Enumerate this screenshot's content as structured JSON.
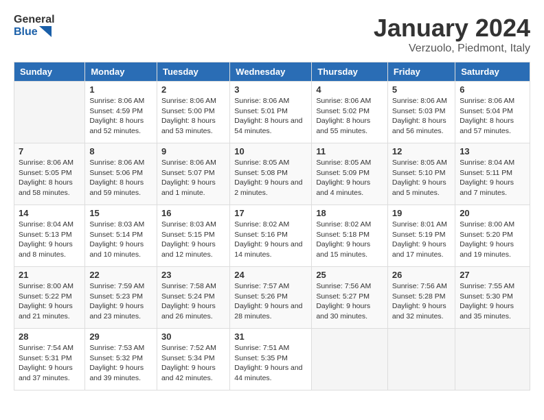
{
  "logo": {
    "text_general": "General",
    "text_blue": "Blue"
  },
  "header": {
    "month": "January 2024",
    "location": "Verzuolo, Piedmont, Italy"
  },
  "weekdays": [
    "Sunday",
    "Monday",
    "Tuesday",
    "Wednesday",
    "Thursday",
    "Friday",
    "Saturday"
  ],
  "weeks": [
    [
      {
        "day": "",
        "sunrise": "",
        "sunset": "",
        "daylight": ""
      },
      {
        "day": "1",
        "sunrise": "Sunrise: 8:06 AM",
        "sunset": "Sunset: 4:59 PM",
        "daylight": "Daylight: 8 hours and 52 minutes."
      },
      {
        "day": "2",
        "sunrise": "Sunrise: 8:06 AM",
        "sunset": "Sunset: 5:00 PM",
        "daylight": "Daylight: 8 hours and 53 minutes."
      },
      {
        "day": "3",
        "sunrise": "Sunrise: 8:06 AM",
        "sunset": "Sunset: 5:01 PM",
        "daylight": "Daylight: 8 hours and 54 minutes."
      },
      {
        "day": "4",
        "sunrise": "Sunrise: 8:06 AM",
        "sunset": "Sunset: 5:02 PM",
        "daylight": "Daylight: 8 hours and 55 minutes."
      },
      {
        "day": "5",
        "sunrise": "Sunrise: 8:06 AM",
        "sunset": "Sunset: 5:03 PM",
        "daylight": "Daylight: 8 hours and 56 minutes."
      },
      {
        "day": "6",
        "sunrise": "Sunrise: 8:06 AM",
        "sunset": "Sunset: 5:04 PM",
        "daylight": "Daylight: 8 hours and 57 minutes."
      }
    ],
    [
      {
        "day": "7",
        "sunrise": "Sunrise: 8:06 AM",
        "sunset": "Sunset: 5:05 PM",
        "daylight": "Daylight: 8 hours and 58 minutes."
      },
      {
        "day": "8",
        "sunrise": "Sunrise: 8:06 AM",
        "sunset": "Sunset: 5:06 PM",
        "daylight": "Daylight: 8 hours and 59 minutes."
      },
      {
        "day": "9",
        "sunrise": "Sunrise: 8:06 AM",
        "sunset": "Sunset: 5:07 PM",
        "daylight": "Daylight: 9 hours and 1 minute."
      },
      {
        "day": "10",
        "sunrise": "Sunrise: 8:05 AM",
        "sunset": "Sunset: 5:08 PM",
        "daylight": "Daylight: 9 hours and 2 minutes."
      },
      {
        "day": "11",
        "sunrise": "Sunrise: 8:05 AM",
        "sunset": "Sunset: 5:09 PM",
        "daylight": "Daylight: 9 hours and 4 minutes."
      },
      {
        "day": "12",
        "sunrise": "Sunrise: 8:05 AM",
        "sunset": "Sunset: 5:10 PM",
        "daylight": "Daylight: 9 hours and 5 minutes."
      },
      {
        "day": "13",
        "sunrise": "Sunrise: 8:04 AM",
        "sunset": "Sunset: 5:11 PM",
        "daylight": "Daylight: 9 hours and 7 minutes."
      }
    ],
    [
      {
        "day": "14",
        "sunrise": "Sunrise: 8:04 AM",
        "sunset": "Sunset: 5:13 PM",
        "daylight": "Daylight: 9 hours and 8 minutes."
      },
      {
        "day": "15",
        "sunrise": "Sunrise: 8:03 AM",
        "sunset": "Sunset: 5:14 PM",
        "daylight": "Daylight: 9 hours and 10 minutes."
      },
      {
        "day": "16",
        "sunrise": "Sunrise: 8:03 AM",
        "sunset": "Sunset: 5:15 PM",
        "daylight": "Daylight: 9 hours and 12 minutes."
      },
      {
        "day": "17",
        "sunrise": "Sunrise: 8:02 AM",
        "sunset": "Sunset: 5:16 PM",
        "daylight": "Daylight: 9 hours and 14 minutes."
      },
      {
        "day": "18",
        "sunrise": "Sunrise: 8:02 AM",
        "sunset": "Sunset: 5:18 PM",
        "daylight": "Daylight: 9 hours and 15 minutes."
      },
      {
        "day": "19",
        "sunrise": "Sunrise: 8:01 AM",
        "sunset": "Sunset: 5:19 PM",
        "daylight": "Daylight: 9 hours and 17 minutes."
      },
      {
        "day": "20",
        "sunrise": "Sunrise: 8:00 AM",
        "sunset": "Sunset: 5:20 PM",
        "daylight": "Daylight: 9 hours and 19 minutes."
      }
    ],
    [
      {
        "day": "21",
        "sunrise": "Sunrise: 8:00 AM",
        "sunset": "Sunset: 5:22 PM",
        "daylight": "Daylight: 9 hours and 21 minutes."
      },
      {
        "day": "22",
        "sunrise": "Sunrise: 7:59 AM",
        "sunset": "Sunset: 5:23 PM",
        "daylight": "Daylight: 9 hours and 23 minutes."
      },
      {
        "day": "23",
        "sunrise": "Sunrise: 7:58 AM",
        "sunset": "Sunset: 5:24 PM",
        "daylight": "Daylight: 9 hours and 26 minutes."
      },
      {
        "day": "24",
        "sunrise": "Sunrise: 7:57 AM",
        "sunset": "Sunset: 5:26 PM",
        "daylight": "Daylight: 9 hours and 28 minutes."
      },
      {
        "day": "25",
        "sunrise": "Sunrise: 7:56 AM",
        "sunset": "Sunset: 5:27 PM",
        "daylight": "Daylight: 9 hours and 30 minutes."
      },
      {
        "day": "26",
        "sunrise": "Sunrise: 7:56 AM",
        "sunset": "Sunset: 5:28 PM",
        "daylight": "Daylight: 9 hours and 32 minutes."
      },
      {
        "day": "27",
        "sunrise": "Sunrise: 7:55 AM",
        "sunset": "Sunset: 5:30 PM",
        "daylight": "Daylight: 9 hours and 35 minutes."
      }
    ],
    [
      {
        "day": "28",
        "sunrise": "Sunrise: 7:54 AM",
        "sunset": "Sunset: 5:31 PM",
        "daylight": "Daylight: 9 hours and 37 minutes."
      },
      {
        "day": "29",
        "sunrise": "Sunrise: 7:53 AM",
        "sunset": "Sunset: 5:32 PM",
        "daylight": "Daylight: 9 hours and 39 minutes."
      },
      {
        "day": "30",
        "sunrise": "Sunrise: 7:52 AM",
        "sunset": "Sunset: 5:34 PM",
        "daylight": "Daylight: 9 hours and 42 minutes."
      },
      {
        "day": "31",
        "sunrise": "Sunrise: 7:51 AM",
        "sunset": "Sunset: 5:35 PM",
        "daylight": "Daylight: 9 hours and 44 minutes."
      },
      {
        "day": "",
        "sunrise": "",
        "sunset": "",
        "daylight": ""
      },
      {
        "day": "",
        "sunrise": "",
        "sunset": "",
        "daylight": ""
      },
      {
        "day": "",
        "sunrise": "",
        "sunset": "",
        "daylight": ""
      }
    ]
  ]
}
